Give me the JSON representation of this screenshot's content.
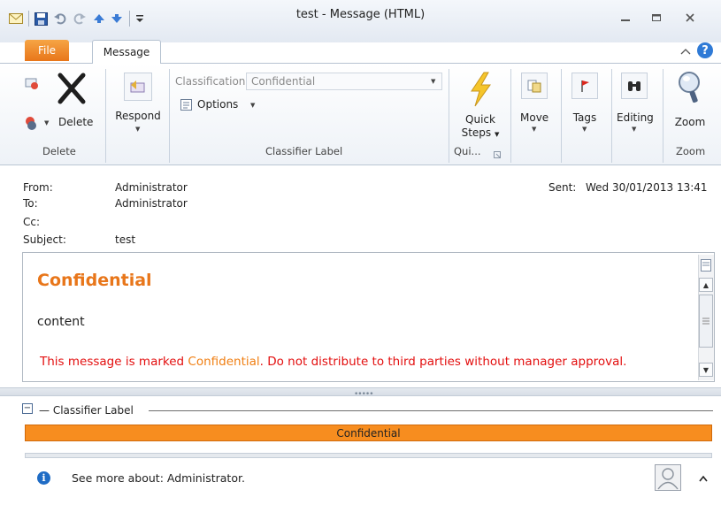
{
  "window": {
    "title": "test - Message (HTML)"
  },
  "tabs": [
    {
      "label": "File"
    },
    {
      "label": "Message"
    }
  ],
  "ribbon": {
    "delete_group": {
      "delete_label": "Delete",
      "group_label": "Delete"
    },
    "respond": {
      "label": "Respond"
    },
    "classifier_group": {
      "classification_label": "Classification",
      "classification_value": "Confidential",
      "options_label": "Options",
      "group_label": "Classifier Label"
    },
    "quick_steps": {
      "label_line1": "Quick",
      "label_line2": "Steps",
      "group_label": "Qui..."
    },
    "move": {
      "label": "Move"
    },
    "tags": {
      "label": "Tags"
    },
    "editing": {
      "label": "Editing"
    },
    "zoom": {
      "label": "Zoom",
      "group_label": "Zoom"
    }
  },
  "header": {
    "from_label": "From:",
    "from_value": "Administrator",
    "to_label": "To:",
    "to_value": "Administrator",
    "cc_label": "Cc:",
    "subject_label": "Subject:",
    "subject_value": "test",
    "sent_label": "Sent:",
    "sent_value": "Wed 30/01/2013 13:41"
  },
  "message": {
    "heading": "Confidential",
    "content": "content",
    "notice_prefix": "This message is marked ",
    "notice_highlight": "Confidential",
    "notice_suffix": ". Do not distribute to third parties without manager approval."
  },
  "classifier": {
    "section_title": "Classifier Label",
    "bar_label": "Confidential",
    "collapse_symbol": "−"
  },
  "people_pane": {
    "info_text": "See more about: Administrator."
  },
  "colors": {
    "accent_orange": "#f78d1f",
    "notice_red": "#e30f0f",
    "file_tab": "#e8761a"
  }
}
